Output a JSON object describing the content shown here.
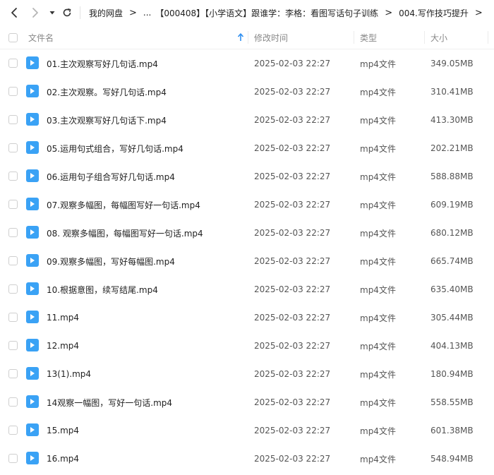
{
  "toolbar": {
    "back_icon": "chevron-left-icon",
    "forward_icon": "chevron-right-icon",
    "history_icon": "caret-down-icon",
    "refresh_icon": "refresh-icon"
  },
  "breadcrumb": [
    "我的网盘",
    "...",
    "【000408】【小学语文】跟谁学：李格：看图写话句子训练",
    "004.写作技巧提升"
  ],
  "breadcrumb_separator": ">",
  "table": {
    "columns": {
      "name": "文件名",
      "modified": "修改时间",
      "type": "类型",
      "size": "大小"
    },
    "sort": {
      "column": "name",
      "direction": "ascending"
    },
    "rows": [
      {
        "name": "01.主次观察写好几句话.mp4",
        "modified": "2025-02-03 22:27",
        "type": "mp4文件",
        "size": "349.05MB"
      },
      {
        "name": "02.主次观察。写好几句话.mp4",
        "modified": "2025-02-03 22:27",
        "type": "mp4文件",
        "size": "310.41MB"
      },
      {
        "name": "03.主次观察写好几句话下.mp4",
        "modified": "2025-02-03 22:27",
        "type": "mp4文件",
        "size": "413.30MB"
      },
      {
        "name": "05.运用句式组合，写好几句话.mp4",
        "modified": "2025-02-03 22:27",
        "type": "mp4文件",
        "size": "202.21MB"
      },
      {
        "name": "06.运用句子组合写好几句话.mp4",
        "modified": "2025-02-03 22:27",
        "type": "mp4文件",
        "size": "588.88MB"
      },
      {
        "name": "07.观察多幅图，每幅图写好一句话.mp4",
        "modified": "2025-02-03 22:27",
        "type": "mp4文件",
        "size": "609.19MB"
      },
      {
        "name": "08. 观察多幅图，每幅图写好一句话.mp4",
        "modified": "2025-02-03 22:27",
        "type": "mp4文件",
        "size": "680.12MB"
      },
      {
        "name": "09.观察多幅图，写好每幅图.mp4",
        "modified": "2025-02-03 22:27",
        "type": "mp4文件",
        "size": "665.74MB"
      },
      {
        "name": "10.根据意图，续写结尾.mp4",
        "modified": "2025-02-03 22:27",
        "type": "mp4文件",
        "size": "635.40MB"
      },
      {
        "name": "11.mp4",
        "modified": "2025-02-03 22:27",
        "type": "mp4文件",
        "size": "305.44MB"
      },
      {
        "name": "12.mp4",
        "modified": "2025-02-03 22:27",
        "type": "mp4文件",
        "size": "404.13MB"
      },
      {
        "name": "13(1).mp4",
        "modified": "2025-02-03 22:27",
        "type": "mp4文件",
        "size": "180.94MB"
      },
      {
        "name": "14观察一幅图，写好一句话.mp4",
        "modified": "2025-02-03 22:27",
        "type": "mp4文件",
        "size": "558.55MB"
      },
      {
        "name": "15.mp4",
        "modified": "2025-02-03 22:27",
        "type": "mp4文件",
        "size": "601.38MB"
      },
      {
        "name": "16.mp4",
        "modified": "2025-02-03 22:27",
        "type": "mp4文件",
        "size": "548.94MB"
      }
    ]
  },
  "colors": {
    "file_icon": "#3aa2f5",
    "sort_arrow": "#2f8ff0"
  }
}
